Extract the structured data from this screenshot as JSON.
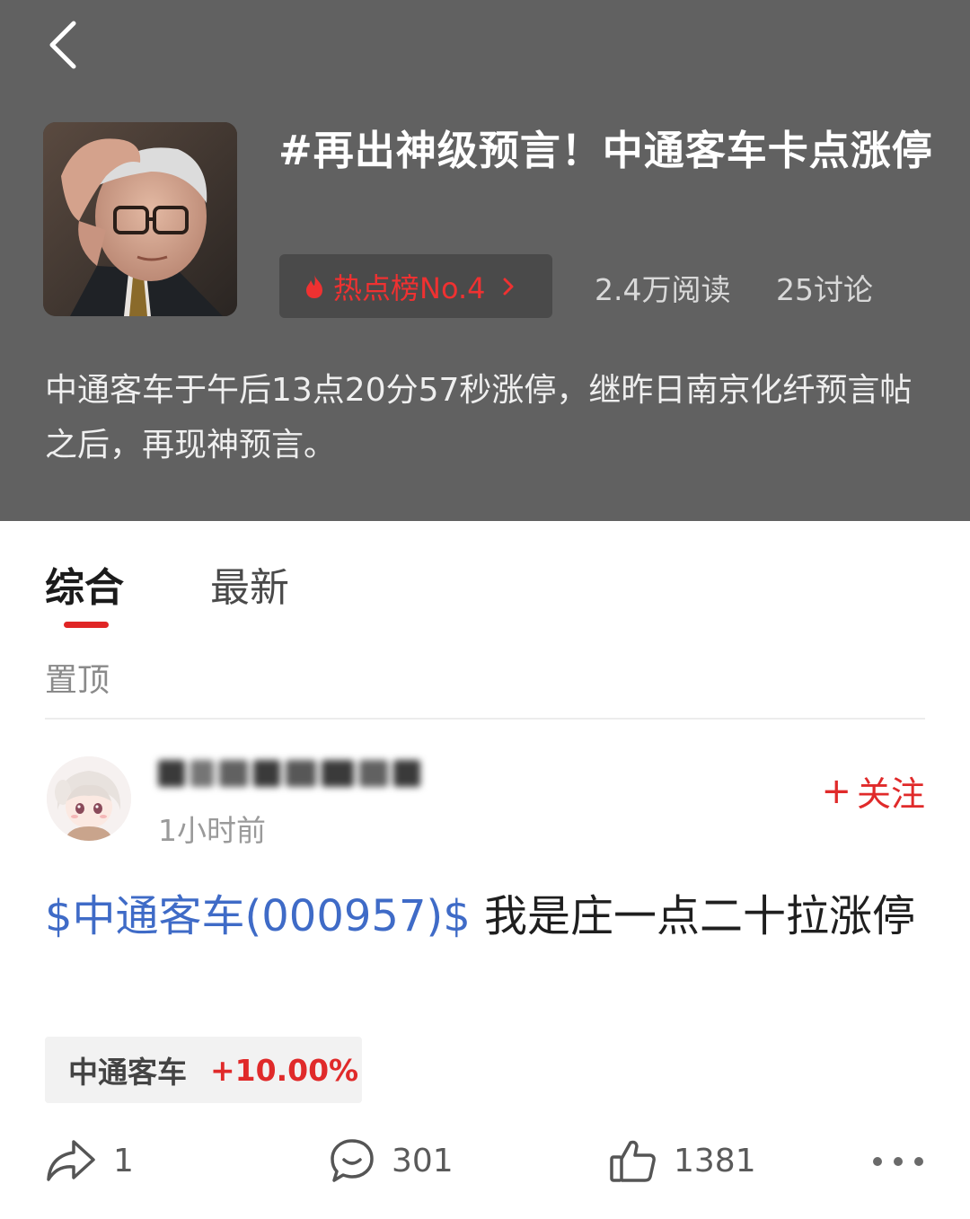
{
  "topic": {
    "title": "#再出神级预言！中通客车卡点涨停",
    "hot_rank_label": "热点榜No.4",
    "reads": "2.4万阅读",
    "discussions": "25讨论",
    "description": "中通客车于午后13点20分57秒涨停，继昨日南京化纤预言帖之后，再现神预言。"
  },
  "tabs": [
    {
      "label": "综合",
      "active": true
    },
    {
      "label": "最新",
      "active": false
    }
  ],
  "pinned_label": "置顶",
  "post": {
    "time": "1小时前",
    "follow_label": "关注",
    "stock_mention": "$中通客车(000957)$",
    "text": " 我是庄一点二十拉涨停",
    "stock_chip": {
      "name": "中通客车",
      "change": "+10.00%"
    },
    "actions": {
      "shares": "1",
      "comments": "301",
      "likes": "1381"
    }
  },
  "colors": {
    "header_bg": "#616161",
    "accent_red": "#e02a2a",
    "link_blue": "#3f6bc7"
  },
  "icons": [
    "back-arrow-icon",
    "flame-icon",
    "chevron-right-icon",
    "share-icon",
    "comment-icon",
    "thumbs-up-icon",
    "more-icon"
  ]
}
